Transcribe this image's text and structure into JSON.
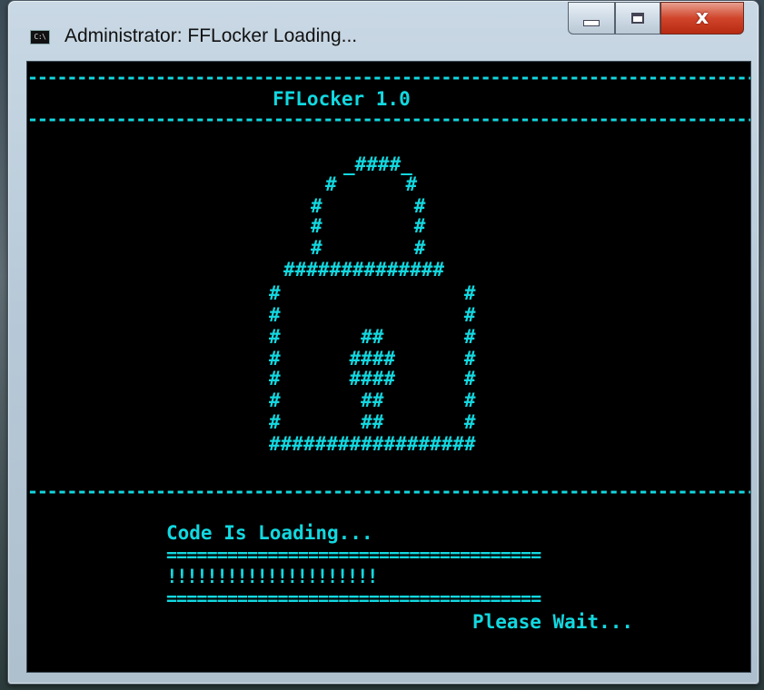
{
  "window": {
    "title": "Administrator:  FFLocker Loading...",
    "icon_text": "C:\\",
    "controls": {
      "minimize": "minimize-icon",
      "maximize": "maximize-icon",
      "close": "close-icon",
      "close_glyph": "x"
    }
  },
  "console": {
    "text_color": "#12d8e0",
    "background": "#000000",
    "top_rule": "----------------------------------------------------------------------------------------------------",
    "heading": "FFLocker 1.0",
    "heading_rule": "----------------------------------------------------------------------------------------------------",
    "lock_art": [
      "_####_ ",
      "#      #",
      "#        #",
      "#        #",
      "#        #",
      "##############",
      "#                #",
      "#                #",
      "#       ##       #",
      "#      ####      #",
      "#      ####      #",
      "#       ##       #",
      "#       ##       #",
      "##################"
    ],
    "bottom_rule": "----------------------------------------------------------------------------------------------------",
    "status_label": "Code Is Loading...",
    "progress_rule_top": "=====================================",
    "progress_bar": "!!!!!!!!!!!!!!!!!!!!!",
    "progress_rule_bottom": "=====================================",
    "wait_label": "Please Wait..."
  }
}
